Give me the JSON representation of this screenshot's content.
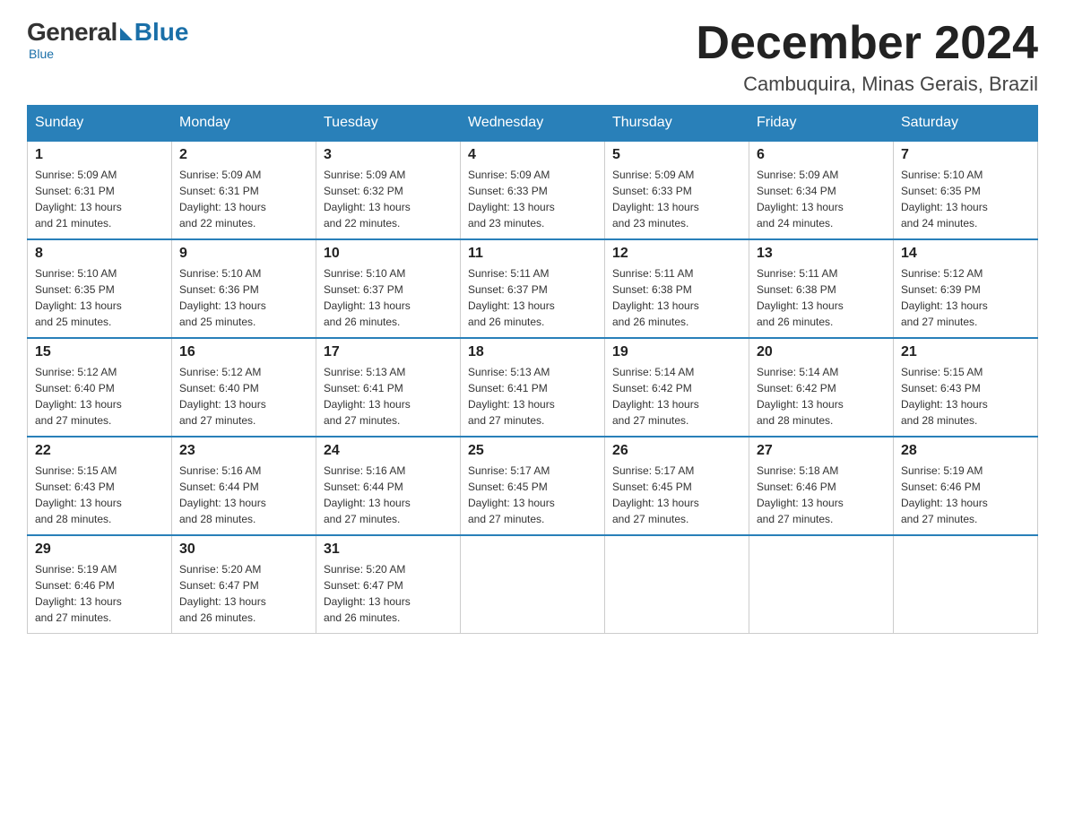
{
  "header": {
    "logo_general": "General",
    "logo_blue": "Blue",
    "month_title": "December 2024",
    "subtitle": "Cambuquira, Minas Gerais, Brazil"
  },
  "weekdays": [
    "Sunday",
    "Monday",
    "Tuesday",
    "Wednesday",
    "Thursday",
    "Friday",
    "Saturday"
  ],
  "weeks": [
    [
      {
        "day": "1",
        "info": "Sunrise: 5:09 AM\nSunset: 6:31 PM\nDaylight: 13 hours\nand 21 minutes."
      },
      {
        "day": "2",
        "info": "Sunrise: 5:09 AM\nSunset: 6:31 PM\nDaylight: 13 hours\nand 22 minutes."
      },
      {
        "day": "3",
        "info": "Sunrise: 5:09 AM\nSunset: 6:32 PM\nDaylight: 13 hours\nand 22 minutes."
      },
      {
        "day": "4",
        "info": "Sunrise: 5:09 AM\nSunset: 6:33 PM\nDaylight: 13 hours\nand 23 minutes."
      },
      {
        "day": "5",
        "info": "Sunrise: 5:09 AM\nSunset: 6:33 PM\nDaylight: 13 hours\nand 23 minutes."
      },
      {
        "day": "6",
        "info": "Sunrise: 5:09 AM\nSunset: 6:34 PM\nDaylight: 13 hours\nand 24 minutes."
      },
      {
        "day": "7",
        "info": "Sunrise: 5:10 AM\nSunset: 6:35 PM\nDaylight: 13 hours\nand 24 minutes."
      }
    ],
    [
      {
        "day": "8",
        "info": "Sunrise: 5:10 AM\nSunset: 6:35 PM\nDaylight: 13 hours\nand 25 minutes."
      },
      {
        "day": "9",
        "info": "Sunrise: 5:10 AM\nSunset: 6:36 PM\nDaylight: 13 hours\nand 25 minutes."
      },
      {
        "day": "10",
        "info": "Sunrise: 5:10 AM\nSunset: 6:37 PM\nDaylight: 13 hours\nand 26 minutes."
      },
      {
        "day": "11",
        "info": "Sunrise: 5:11 AM\nSunset: 6:37 PM\nDaylight: 13 hours\nand 26 minutes."
      },
      {
        "day": "12",
        "info": "Sunrise: 5:11 AM\nSunset: 6:38 PM\nDaylight: 13 hours\nand 26 minutes."
      },
      {
        "day": "13",
        "info": "Sunrise: 5:11 AM\nSunset: 6:38 PM\nDaylight: 13 hours\nand 26 minutes."
      },
      {
        "day": "14",
        "info": "Sunrise: 5:12 AM\nSunset: 6:39 PM\nDaylight: 13 hours\nand 27 minutes."
      }
    ],
    [
      {
        "day": "15",
        "info": "Sunrise: 5:12 AM\nSunset: 6:40 PM\nDaylight: 13 hours\nand 27 minutes."
      },
      {
        "day": "16",
        "info": "Sunrise: 5:12 AM\nSunset: 6:40 PM\nDaylight: 13 hours\nand 27 minutes."
      },
      {
        "day": "17",
        "info": "Sunrise: 5:13 AM\nSunset: 6:41 PM\nDaylight: 13 hours\nand 27 minutes."
      },
      {
        "day": "18",
        "info": "Sunrise: 5:13 AM\nSunset: 6:41 PM\nDaylight: 13 hours\nand 27 minutes."
      },
      {
        "day": "19",
        "info": "Sunrise: 5:14 AM\nSunset: 6:42 PM\nDaylight: 13 hours\nand 27 minutes."
      },
      {
        "day": "20",
        "info": "Sunrise: 5:14 AM\nSunset: 6:42 PM\nDaylight: 13 hours\nand 28 minutes."
      },
      {
        "day": "21",
        "info": "Sunrise: 5:15 AM\nSunset: 6:43 PM\nDaylight: 13 hours\nand 28 minutes."
      }
    ],
    [
      {
        "day": "22",
        "info": "Sunrise: 5:15 AM\nSunset: 6:43 PM\nDaylight: 13 hours\nand 28 minutes."
      },
      {
        "day": "23",
        "info": "Sunrise: 5:16 AM\nSunset: 6:44 PM\nDaylight: 13 hours\nand 28 minutes."
      },
      {
        "day": "24",
        "info": "Sunrise: 5:16 AM\nSunset: 6:44 PM\nDaylight: 13 hours\nand 27 minutes."
      },
      {
        "day": "25",
        "info": "Sunrise: 5:17 AM\nSunset: 6:45 PM\nDaylight: 13 hours\nand 27 minutes."
      },
      {
        "day": "26",
        "info": "Sunrise: 5:17 AM\nSunset: 6:45 PM\nDaylight: 13 hours\nand 27 minutes."
      },
      {
        "day": "27",
        "info": "Sunrise: 5:18 AM\nSunset: 6:46 PM\nDaylight: 13 hours\nand 27 minutes."
      },
      {
        "day": "28",
        "info": "Sunrise: 5:19 AM\nSunset: 6:46 PM\nDaylight: 13 hours\nand 27 minutes."
      }
    ],
    [
      {
        "day": "29",
        "info": "Sunrise: 5:19 AM\nSunset: 6:46 PM\nDaylight: 13 hours\nand 27 minutes."
      },
      {
        "day": "30",
        "info": "Sunrise: 5:20 AM\nSunset: 6:47 PM\nDaylight: 13 hours\nand 26 minutes."
      },
      {
        "day": "31",
        "info": "Sunrise: 5:20 AM\nSunset: 6:47 PM\nDaylight: 13 hours\nand 26 minutes."
      },
      {
        "day": "",
        "info": ""
      },
      {
        "day": "",
        "info": ""
      },
      {
        "day": "",
        "info": ""
      },
      {
        "day": "",
        "info": ""
      }
    ]
  ]
}
